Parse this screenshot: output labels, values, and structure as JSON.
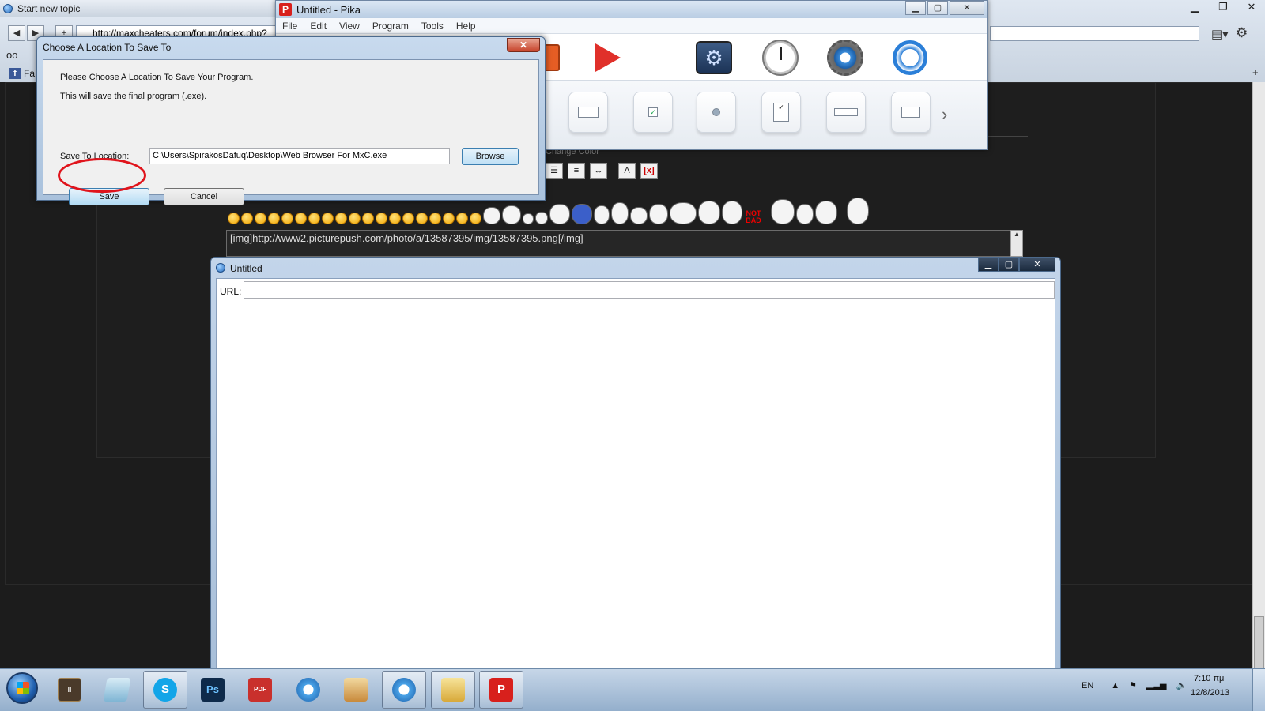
{
  "browser": {
    "tab_title": "Start new topic",
    "url": "http://maxcheaters.com/forum/index.php?",
    "bookmark_facebook": "Fa",
    "nav_back": "◀",
    "nav_forward": "▶",
    "new_tab": "+"
  },
  "forum": {
    "textarea_value": "[img]http://www2.picturepush.com/photo/a/13587395/img/13587395.png[/img]",
    "font_selects_text": "Change Color",
    "not_bad_text": "NOT BAD"
  },
  "pika": {
    "title": "Untitled - Pika",
    "logo_letter": "P",
    "menu": [
      "File",
      "Edit",
      "View",
      "Program",
      "Tools",
      "Help"
    ]
  },
  "save_dialog": {
    "title": "Choose A Location To Save To",
    "close_glyph": "✕",
    "line1": "Please Choose A Location To Save Your Program.",
    "line2": "This will save the final program (.exe).",
    "save_to_label": "Save To Location:",
    "save_path": "C:\\Users\\SpirakosDafuq\\Desktop\\Web Browser For MxC.exe",
    "browse_label": "Browse",
    "save_label": "Save",
    "cancel_label": "Cancel"
  },
  "form_window": {
    "title": "Untitled",
    "url_label": "URL:",
    "url_value": ""
  },
  "taskbar": {
    "apps": [
      "Lineage II",
      "Notepad",
      "Skype",
      "Photoshop",
      "PDF",
      "Safari",
      "Photo",
      "Safari",
      "Explorer",
      "Pika"
    ],
    "tray_lang": "EN",
    "time": "7:10 πμ",
    "date": "12/8/2013"
  },
  "colors": {
    "highlight_circle": "#e0141c",
    "pika_logo": "#d8201c",
    "taskbar": "#a9c0da"
  }
}
